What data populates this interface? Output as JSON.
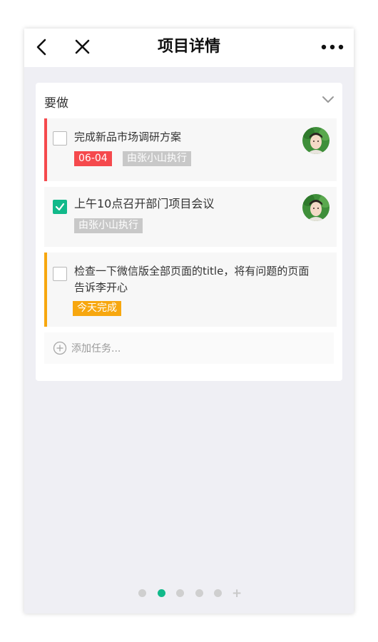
{
  "navbar": {
    "title": "项目详情",
    "back_icon": "chevron-left-icon",
    "close_icon": "close-icon",
    "more_icon": "more-horizontal-icon"
  },
  "section": {
    "title": "要做",
    "collapse_icon": "chevron-down-icon"
  },
  "tasks": [
    {
      "title": "完成新品市场调研方案",
      "checked": false,
      "accent": "#f5494d",
      "tags": [
        {
          "text": "06-04",
          "kind": "date"
        },
        {
          "text": "由张小山执行",
          "kind": "assignee"
        }
      ],
      "has_avatar": true
    },
    {
      "title": "上午10点召开部门项目会议",
      "checked": true,
      "tags": [
        {
          "text": "由张小山执行",
          "kind": "assignee"
        }
      ],
      "has_avatar": true
    },
    {
      "title_line1": "检查一下微信版全部页面的title，将有问题的页面",
      "title_line2": "告诉李开心",
      "checked": false,
      "accent": "#f7a70f",
      "tags": [
        {
          "text": "今天完成",
          "kind": "due"
        }
      ],
      "has_avatar": false
    }
  ],
  "add_task": {
    "placeholder": "添加任务..."
  },
  "pager": {
    "count": 5,
    "active_index": 1
  },
  "colors": {
    "primary": "#11b98a",
    "danger": "#f5494d",
    "warning": "#f7a70f",
    "background": "#efeff4"
  }
}
